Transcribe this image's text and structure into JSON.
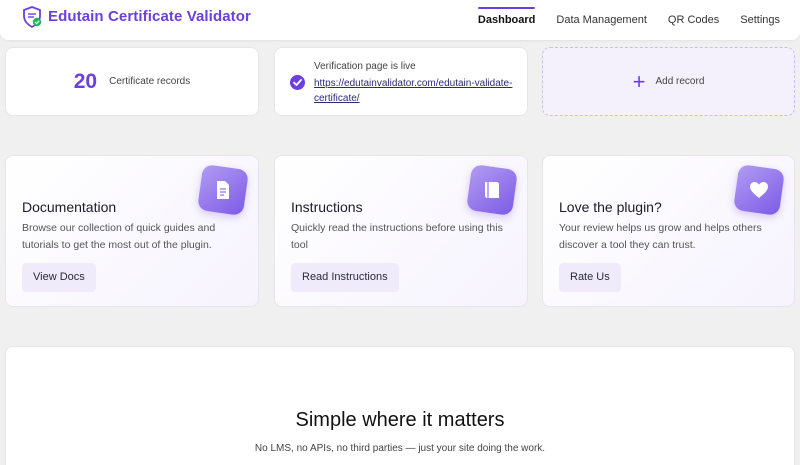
{
  "header": {
    "title": "Edutain Certificate Validator",
    "nav": [
      {
        "label": "Dashboard",
        "active": true
      },
      {
        "label": "Data Management",
        "active": false
      },
      {
        "label": "QR Codes",
        "active": false
      },
      {
        "label": "Settings",
        "active": false
      }
    ]
  },
  "stats": {
    "records_count": "20",
    "records_label": "Certificate records",
    "live_title": "Verification page is live",
    "live_url": "https://edutainvalidator.com/edutain-validate-certificate/",
    "add_label": "Add record"
  },
  "features": [
    {
      "icon": "document-icon",
      "title": "Documentation",
      "description": "Browse our collection of quick guides and tutorials to get the most out of the plugin.",
      "button": "View Docs"
    },
    {
      "icon": "book-icon",
      "title": "Instructions",
      "description": "Quickly read the instructions before using this tool",
      "button": "Read Instructions"
    },
    {
      "icon": "heart-icon",
      "title": "Love the plugin?",
      "description": "Your review helps us grow and helps others discover a tool they can trust.",
      "button": "Rate Us"
    }
  ],
  "promo": {
    "title": "Simple where it matters",
    "subtitle": "No LMS, no APIs, no third parties — just your site doing the work."
  },
  "colors": {
    "accent": "#6b3fe0",
    "background": "#f0f0f0"
  }
}
